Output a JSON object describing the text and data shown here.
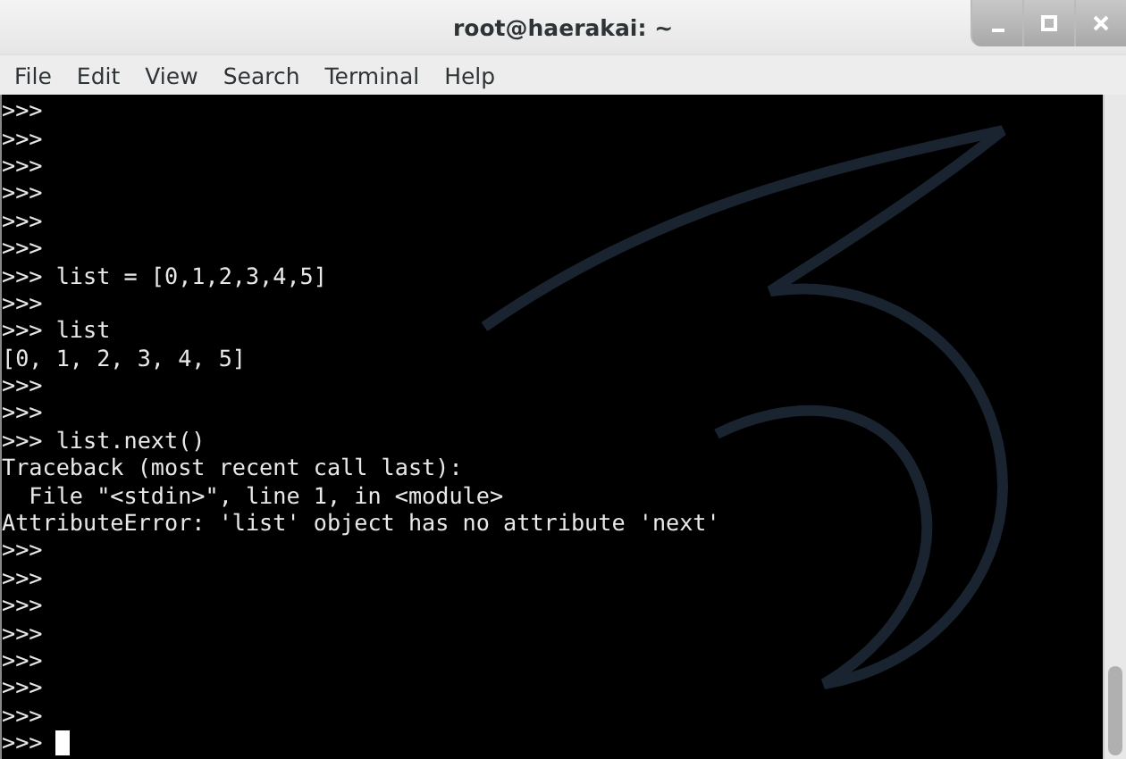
{
  "window": {
    "title": "root@haerakai: ~"
  },
  "menu": [
    "File",
    "Edit",
    "View",
    "Search",
    "Terminal",
    "Help"
  ],
  "terminal": {
    "lines": [
      ">>>",
      ">>>",
      ">>>",
      ">>>",
      ">>>",
      ">>>",
      ">>> list = [0,1,2,3,4,5]",
      ">>>",
      ">>> list",
      "[0, 1, 2, 3, 4, 5]",
      ">>>",
      ">>>",
      ">>> list.next()",
      "Traceback (most recent call last):",
      "  File \"<stdin>\", line 1, in <module>",
      "AttributeError: 'list' object has no attribute 'next'",
      ">>>",
      ">>>",
      ">>>",
      ">>>",
      ">>>",
      ">>>",
      ">>>",
      ">>>"
    ]
  }
}
